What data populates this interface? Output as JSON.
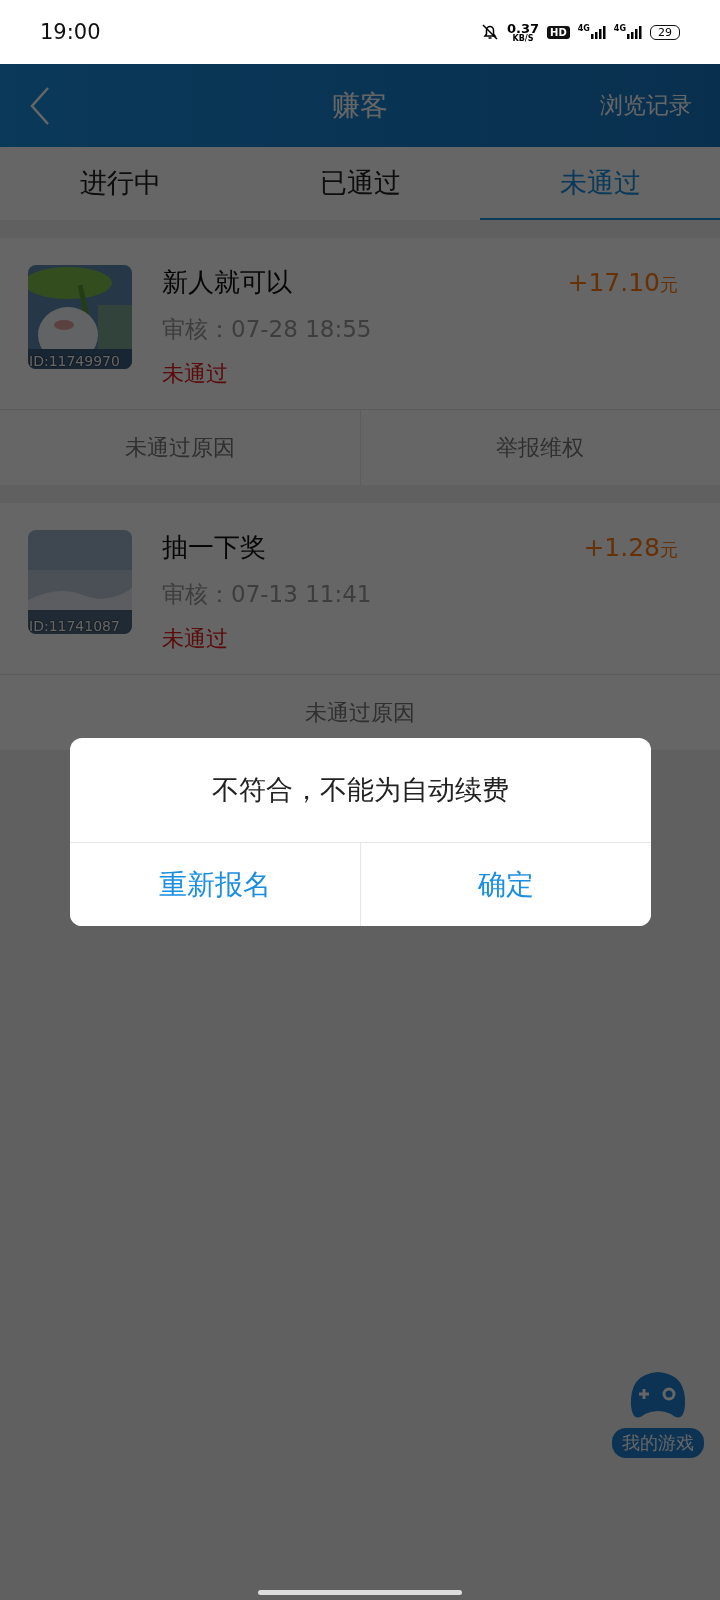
{
  "status_bar": {
    "time": "19:00",
    "net_speed": "0.37",
    "net_unit": "KB/S",
    "hd": "HD",
    "signals": [
      "4G",
      "4G"
    ],
    "battery": "29"
  },
  "header": {
    "title": "赚客",
    "action": "浏览记录"
  },
  "tabs": [
    {
      "label": "进行中",
      "selected": false
    },
    {
      "label": "已通过",
      "selected": false
    },
    {
      "label": "未通过",
      "selected": true
    }
  ],
  "tasks": [
    {
      "title": "新人就可以",
      "amount": "+17.10",
      "unit": "元",
      "review": "审核：07-28 18:55",
      "status": "未通过",
      "id": "ID:11749970",
      "actions": [
        "未通过原因",
        "举报维权"
      ]
    },
    {
      "title": "抽一下奖",
      "amount": "+1.28",
      "unit": "元",
      "review": "审核：07-13 11:41",
      "status": "未通过",
      "id": "ID:11741087",
      "actions": [
        "未通过原因"
      ]
    }
  ],
  "dialog": {
    "message": "不符合，不能为自动续费",
    "buttons": [
      "重新报名",
      "确定"
    ]
  },
  "floating_button": {
    "label": "我的游戏"
  }
}
